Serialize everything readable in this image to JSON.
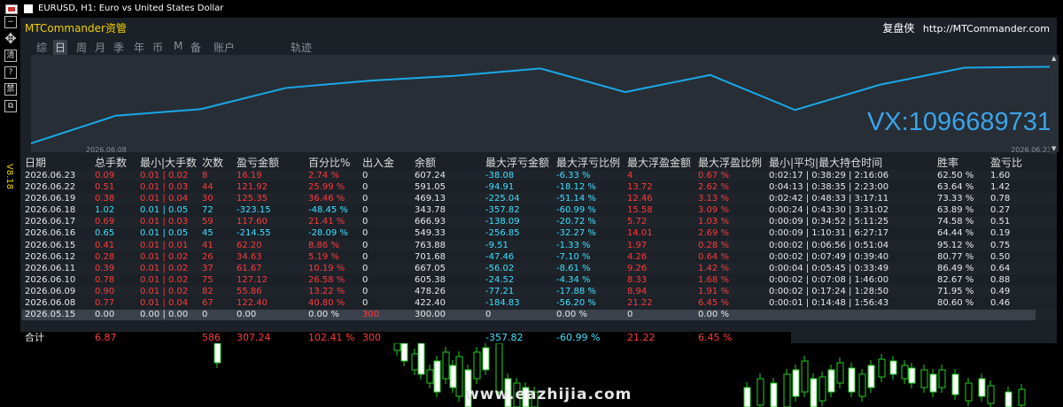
{
  "window": {
    "title": "EURUSD, H1:  Euro vs United States Dollar"
  },
  "toolbar": {
    "tools": [
      {
        "name": "minimize-button",
        "glyph": "−"
      },
      {
        "name": "move-icon",
        "glyph": "✥"
      },
      {
        "name": "clear-button",
        "glyph": "清"
      },
      {
        "name": "help-button",
        "glyph": "?"
      },
      {
        "name": "settings-button",
        "glyph": "禁"
      },
      {
        "name": "restore-button",
        "glyph": "⧉"
      }
    ]
  },
  "version": "V8.18",
  "panel": {
    "title": "MTCommander资管",
    "brand": "复盘侠",
    "url": "http://MTCommander.com"
  },
  "tabs": [
    "综",
    "日",
    "周",
    "月",
    "季",
    "年",
    "币",
    "M",
    "备",
    "账户",
    "轨迹"
  ],
  "active_tab": "日",
  "curve": {
    "start_date": "2026.06.08",
    "end_date": "2026.06.23",
    "watermark": "VX:1096689731",
    "color": "#1aa8e8",
    "points": [
      0,
      0.34,
      0.42,
      0.68,
      0.77,
      0.83,
      0.92,
      0.63,
      0.84,
      0.41,
      0.72,
      0.93,
      0.94
    ]
  },
  "table": {
    "headers": [
      "日期",
      "总手数",
      "最小|大手数",
      "次数",
      "盈亏金额",
      "百分比%",
      "出入金",
      "余额",
      "最大浮亏金额",
      "最大浮亏比例",
      "最大浮盈金额",
      "最大浮盈比例",
      "最小|平均|最大持仓时间",
      "胜率",
      "盈亏比"
    ],
    "rows": [
      {
        "date": "2026.06.23",
        "lots": "0.09",
        "minmax": "0.01 | 0.02",
        "count": "8",
        "pnl": "16.19",
        "pct": "2.74 %",
        "io": "0",
        "balance": "607.24",
        "mdd": "-38.08",
        "mddp": "-6.33 %",
        "mfe": "4",
        "mfep": "0.67 %",
        "hold": "0:02:17 | 0:38:29 | 2:16:06",
        "win": "62.50 %",
        "pf": "1.60",
        "color": "red"
      },
      {
        "date": "2026.06.22",
        "lots": "0.51",
        "minmax": "0.01 | 0.03",
        "count": "44",
        "pnl": "121.92",
        "pct": "25.99 %",
        "io": "0",
        "balance": "591.05",
        "mdd": "-94.91",
        "mddp": "-18.12 %",
        "mfe": "13.72",
        "mfep": "2.62 %",
        "hold": "0:04:13 | 0:38:35 | 2:23:00",
        "win": "63.64 %",
        "pf": "1.42",
        "color": "red"
      },
      {
        "date": "2026.06.19",
        "lots": "0.38",
        "minmax": "0.01 | 0.04",
        "count": "30",
        "pnl": "125.35",
        "pct": "36.46 %",
        "io": "0",
        "balance": "469.13",
        "mdd": "-225.04",
        "mddp": "-51.14 %",
        "mfe": "12.46",
        "mfep": "3.13 %",
        "hold": "0:02:42 | 0:48:33 | 3:17:11",
        "win": "73.33 %",
        "pf": "0.78",
        "color": "red"
      },
      {
        "date": "2026.06.18",
        "lots": "1.02",
        "minmax": "0.01 | 0.05",
        "count": "72",
        "pnl": "-323.15",
        "pct": "-48.45 %",
        "io": "0",
        "balance": "343.78",
        "mdd": "-357.82",
        "mddp": "-60.99 %",
        "mfe": "15.58",
        "mfep": "3.09 %",
        "hold": "0:00:24 | 0:43:30 | 3:31:02",
        "win": "63.89 %",
        "pf": "0.27",
        "color": "cyan"
      },
      {
        "date": "2026.06.17",
        "lots": "0.69",
        "minmax": "0.01 | 0.03",
        "count": "59",
        "pnl": "117.60",
        "pct": "21.41 %",
        "io": "0",
        "balance": "666.93",
        "mdd": "-138.09",
        "mddp": "-20.72 %",
        "mfe": "5.72",
        "mfep": "1.03 %",
        "hold": "0:00:09 | 0:34:52 | 5:11:25",
        "win": "74.58 %",
        "pf": "0.51",
        "color": "red"
      },
      {
        "date": "2026.06.16",
        "lots": "0.65",
        "minmax": "0.01 | 0.05",
        "count": "45",
        "pnl": "-214.55",
        "pct": "-28.09 %",
        "io": "0",
        "balance": "549.33",
        "mdd": "-256.85",
        "mddp": "-32.27 %",
        "mfe": "14.01",
        "mfep": "2.69 %",
        "hold": "0:00:09 | 1:10:31 | 6:27:17",
        "win": "64.44 %",
        "pf": "0.19",
        "color": "cyan"
      },
      {
        "date": "2026.06.15",
        "lots": "0.41",
        "minmax": "0.01 | 0.01",
        "count": "41",
        "pnl": "62.20",
        "pct": "8.86 %",
        "io": "0",
        "balance": "763.88",
        "mdd": "-9.51",
        "mddp": "-1.33 %",
        "mfe": "1.97",
        "mfep": "0.28 %",
        "hold": "0:00:02 | 0:06:56 | 0:51:04",
        "win": "95.12 %",
        "pf": "0.75",
        "color": "red"
      },
      {
        "date": "2026.06.12",
        "lots": "0.28",
        "minmax": "0.01 | 0.02",
        "count": "26",
        "pnl": "34.63",
        "pct": "5.19 %",
        "io": "0",
        "balance": "701.68",
        "mdd": "-47.46",
        "mddp": "-7.10 %",
        "mfe": "4.26",
        "mfep": "0.64 %",
        "hold": "0:00:02 | 0:07:49 | 0:39:40",
        "win": "80.77 %",
        "pf": "0.50",
        "color": "red"
      },
      {
        "date": "2026.06.11",
        "lots": "0.39",
        "minmax": "0.01 | 0.02",
        "count": "37",
        "pnl": "61.67",
        "pct": "10.19 %",
        "io": "0",
        "balance": "667.05",
        "mdd": "-56.02",
        "mddp": "-8.61 %",
        "mfe": "9.26",
        "mfep": "1.42 %",
        "hold": "0:00:04 | 0:05:45 | 0:33:49",
        "win": "86.49 %",
        "pf": "0.64",
        "color": "red"
      },
      {
        "date": "2026.06.10",
        "lots": "0.78",
        "minmax": "0.01 | 0.02",
        "count": "75",
        "pnl": "127.12",
        "pct": "26.58 %",
        "io": "0",
        "balance": "605.38",
        "mdd": "-24.52",
        "mddp": "-4.34 %",
        "mfe": "8.33",
        "mfep": "1.68 %",
        "hold": "0:00:02 | 0:07:08 | 1:46:00",
        "win": "82.67 %",
        "pf": "0.88",
        "color": "red"
      },
      {
        "date": "2026.06.09",
        "lots": "0.90",
        "minmax": "0.01 | 0.02",
        "count": "82",
        "pnl": "55.86",
        "pct": "13.22 %",
        "io": "0",
        "balance": "478.26",
        "mdd": "-77.21",
        "mddp": "-17.88 %",
        "mfe": "8.94",
        "mfep": "1.91 %",
        "hold": "0:00:02 | 0:17:24 | 1:28:50",
        "win": "71.95 %",
        "pf": "0.49",
        "color": "red"
      },
      {
        "date": "2026.06.08",
        "lots": "0.77",
        "minmax": "0.01 | 0.04",
        "count": "67",
        "pnl": "122.40",
        "pct": "40.80 %",
        "io": "0",
        "balance": "422.40",
        "mdd": "-184.83",
        "mddp": "-56.20 %",
        "mfe": "21.22",
        "mfep": "6.45 %",
        "hold": "0:00:01 | 0:14:48 | 1:56:43",
        "win": "80.60 %",
        "pf": "0.46",
        "color": "red"
      },
      {
        "date": "2026.05.15",
        "lots": "0.00",
        "minmax": "0.00 | 0.00",
        "count": "0",
        "pnl": "0.00",
        "pct": "0.00 %",
        "io": "300",
        "balance": "300.00",
        "mdd": "0",
        "mddp": "0.00 %",
        "mfe": "0",
        "mfep": "0.00 %",
        "hold": "",
        "win": "",
        "pf": "",
        "color": "white"
      }
    ],
    "total": {
      "label": "合计",
      "lots": "6.87",
      "count": "586",
      "pnl": "307.24",
      "pct": "102.41 %",
      "io": "300",
      "mdd": "-357.82",
      "mddp": "-60.99 %",
      "mfe": "21.22",
      "mfep": "6.45 %"
    }
  },
  "watermark_site": "www.eazhijia.com",
  "colors": {
    "positive": "#ff3a3a",
    "negative": "#3ee0ff",
    "neutral": "#e8e8e8",
    "panel": "#1c2128",
    "curve": "#1aa8e8",
    "header": "#f0d000"
  }
}
